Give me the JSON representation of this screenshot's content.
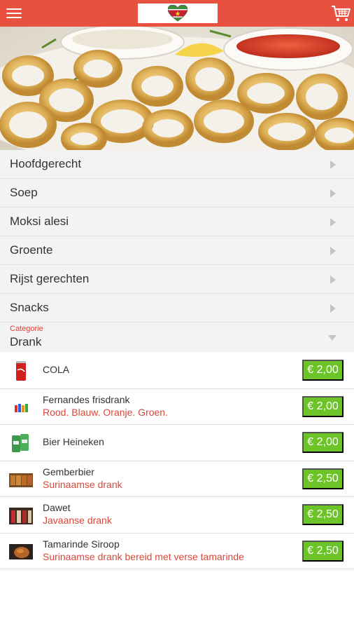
{
  "header": {
    "menu_icon": "hamburger-menu-icon",
    "logo_icon": "suriname-heart-logo",
    "cart_icon": "shopping-cart-icon",
    "bar_color": "#e8503f"
  },
  "hero": {
    "image": "fried-calamari-with-dipping-sauces"
  },
  "categories": [
    {
      "label": "Hoofdgerecht"
    },
    {
      "label": "Soep"
    },
    {
      "label": "Moksi alesi"
    },
    {
      "label": "Groente"
    },
    {
      "label": "Rijst gerechten"
    },
    {
      "label": "Snacks"
    }
  ],
  "selected_category": {
    "caption": "Categorie",
    "label": "Drank"
  },
  "products": [
    {
      "name": "COLA",
      "description": "",
      "price": "€ 2,00",
      "icon": "cola-can-icon"
    },
    {
      "name": "Fernandes frisdrank",
      "description": "Rood. Blauw. Oranje. Groen.",
      "price": "€ 2,00",
      "icon": "fernandes-bottles-icon"
    },
    {
      "name": "Bier Heineken",
      "description": "",
      "price": "€ 2,00",
      "icon": "heineken-cans-icon"
    },
    {
      "name": "Gemberbier",
      "description": "Surinaamse drank",
      "price": "€ 2,50",
      "icon": "gemberbier-icon"
    },
    {
      "name": "Dawet",
      "description": "Javaanse drank",
      "price": "€ 2,50",
      "icon": "dawet-bottles-icon"
    },
    {
      "name": "Tamarinde Siroop",
      "description": "Surinaamse drank bereid met verse tamarinde",
      "price": "€ 2,50",
      "icon": "tamarinde-icon"
    }
  ],
  "colors": {
    "accent": "#e8503f",
    "price_bg": "#6cc429",
    "description": "#d8473a"
  }
}
